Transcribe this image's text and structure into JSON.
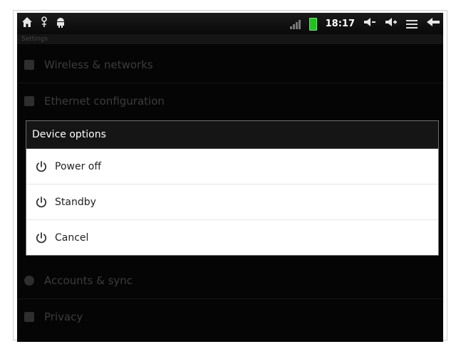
{
  "status_bar": {
    "left_icons": [
      "home-icon",
      "usb-icon",
      "android-debug-icon"
    ],
    "clock": "18:17",
    "right_icons": [
      "signal-icon",
      "battery-icon",
      "volume-down-icon",
      "volume-up-icon",
      "menu-icon",
      "back-icon"
    ],
    "battery_color": "#21c11e"
  },
  "background_screen": {
    "header": "Settings",
    "items": [
      {
        "label": "Wireless & networks",
        "icon": "wifi-icon"
      },
      {
        "label": "Ethernet configuration",
        "icon": "ethernet-icon"
      },
      {
        "label": "Accounts & sync",
        "icon": "sync-icon"
      },
      {
        "label": "Privacy",
        "icon": "privacy-icon"
      }
    ]
  },
  "dialog": {
    "title": "Device options",
    "items": [
      {
        "label": "Power off",
        "icon": "power-icon"
      },
      {
        "label": "Standby",
        "icon": "power-icon"
      },
      {
        "label": "Cancel",
        "icon": "power-icon"
      }
    ]
  },
  "colors": {
    "screen_bg": "#050505",
    "dialog_title_bg": "#151515",
    "dialog_list_bg": "#ffffff",
    "battery": "#21c11e"
  }
}
